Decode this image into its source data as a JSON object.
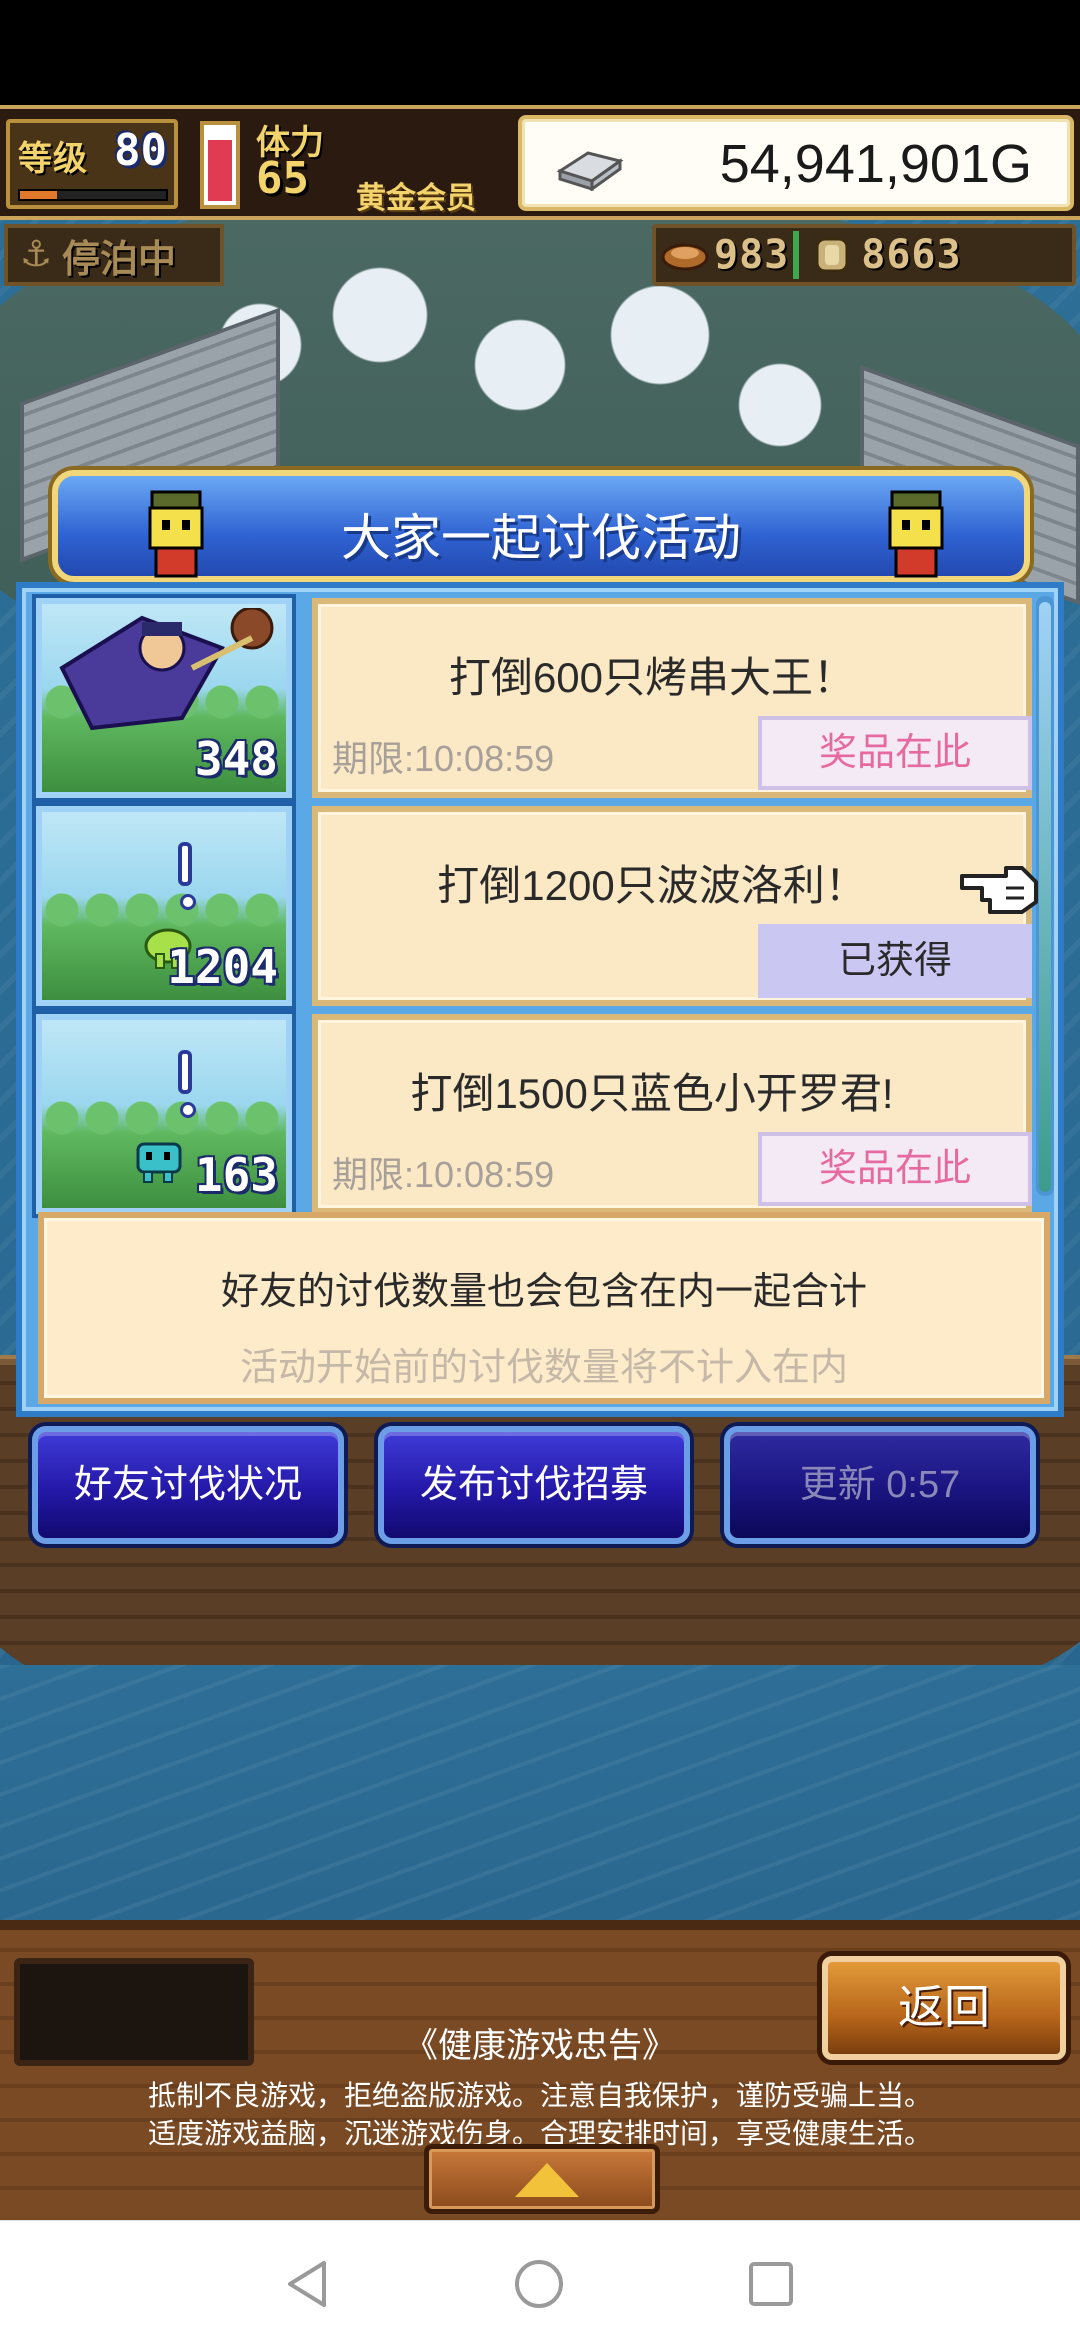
{
  "hud": {
    "level_label": "等级",
    "level_value": "80",
    "level_progress": 0.25,
    "hp_level": 0.85,
    "stamina_label": "体力",
    "stamina_value": "65",
    "membership": "黄金会员",
    "money": "54,941,901G",
    "status": "停泊中",
    "resource1_value": "983",
    "resource2_value": "8663"
  },
  "event": {
    "title": "大家一起讨伐活动",
    "quests": [
      {
        "text": "打倒600只烤串大王！",
        "deadline": "期限:10:08:59",
        "count": "348",
        "reward_label": "奖品在此",
        "status": "available"
      },
      {
        "text": "打倒1200只波波洛利！",
        "deadline": "",
        "count": "1204",
        "reward_label": "已获得",
        "status": "obtained"
      },
      {
        "text": "打倒1500只蓝色小开罗君!",
        "deadline": "期限:10:08:59",
        "count": "163",
        "reward_label": "奖品在此",
        "status": "available"
      }
    ],
    "info_line1": "好友的讨伐数量也会包含在内一起合计",
    "info_line2": "活动开始前的讨伐数量将不计入在内",
    "buttons": {
      "friend_status": "好友讨伐状况",
      "post_recruit": "发布讨伐招募",
      "refresh": "更新 0:57"
    }
  },
  "bottom": {
    "back_label": "返回",
    "health_title": "《健康游戏忠告》",
    "health_line1": "抵制不良游戏，拒绝盗版游戏。注意自我保护，谨防受骗上当。",
    "health_line2": "适度游戏益脑，沉迷游戏伤身。合理安排时间，享受健康生活。"
  },
  "colors": {
    "panel_blue": "#2f62d2",
    "card_bg": "#fbe9c6",
    "reward_pink": "#e66aa0",
    "gold_text": "#f3d36b"
  }
}
